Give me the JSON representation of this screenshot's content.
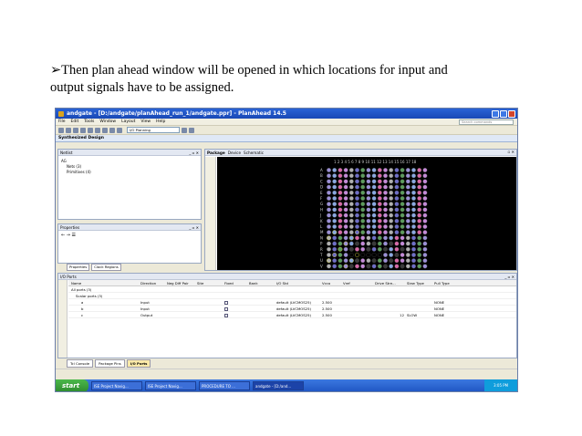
{
  "caption": {
    "line1": "➢Then plan ahead window will be opened in which locations for input and",
    "line2": "output signals have to be assigned."
  },
  "window": {
    "title": "andgate - [D:/andgate/planAhead_run_1/andgate.ppr] - PlanAhead 14.5",
    "menu": [
      "File",
      "Edit",
      "Tools",
      "Window",
      "Layout",
      "View",
      "Help"
    ],
    "search_placeholder": "Search commands",
    "layout_select": "I/O Planning",
    "design_tab": "Synthesized Design"
  },
  "netlist": {
    "title": "Netlist",
    "root": "AG",
    "nets": "Nets (3)",
    "primitives": "Primitives (4)"
  },
  "properties": {
    "title": "Properties",
    "tabs": [
      "Properties",
      "Clock Regions"
    ]
  },
  "package_view": {
    "tabs": [
      "Package",
      "Device",
      "Schematic"
    ],
    "column_numbers": "1 2 3 4 5 6 7 8 9 10 11 12 13 14 15 16 17 18",
    "row_letters": [
      "A",
      "B",
      "C",
      "D",
      "E",
      "F",
      "G",
      "H",
      "J",
      "K",
      "L",
      "M",
      "N",
      "P",
      "R",
      "T",
      "U",
      "V"
    ]
  },
  "io_ports": {
    "title": "I/O Ports",
    "columns": [
      "Name",
      "Direction",
      "Neg Diff Pair",
      "Site",
      "Fixed",
      "Bank",
      "I/O Std",
      "Vcco",
      "Vref",
      "Drive Stre...",
      "Slew Type",
      "Pull Type"
    ],
    "rows": [
      {
        "name": "All ports (3)",
        "direction": "",
        "iostd": "",
        "vcco": "",
        "drive": "",
        "slew": "",
        "pull": "",
        "checkbox": false
      },
      {
        "name": "Scalar ports (3)",
        "direction": "",
        "iostd": "",
        "vcco": "",
        "drive": "",
        "slew": "",
        "pull": "",
        "checkbox": false
      },
      {
        "name": "a",
        "direction": "Input",
        "iostd": "default (LVCMOS25)",
        "vcco": "2.500",
        "drive": "",
        "slew": "",
        "pull": "NONE",
        "checkbox": true
      },
      {
        "name": "b",
        "direction": "Input",
        "iostd": "default (LVCMOS25)",
        "vcco": "2.500",
        "drive": "",
        "slew": "",
        "pull": "NONE",
        "checkbox": true
      },
      {
        "name": "c",
        "direction": "Output",
        "iostd": "default (LVCMOS25)",
        "vcco": "2.500",
        "drive": "12",
        "slew": "SLOW",
        "pull": "NONE",
        "checkbox": true
      }
    ]
  },
  "bottom_tabs": [
    "Tcl Console",
    "Package Pins",
    "I/O Ports"
  ],
  "taskbar": {
    "start": "start",
    "tasks": [
      "ISE Project Navig...",
      "ISE Project Navig...",
      "PROCEDURE TO ...",
      "andgate - [D:/and..."
    ],
    "clock": "3:05 PM"
  },
  "colors": {
    "titlebar": "#1948b5",
    "taskbar": "#1f55c3",
    "start_button": "#2e8b2e",
    "package_background": "#000000"
  }
}
